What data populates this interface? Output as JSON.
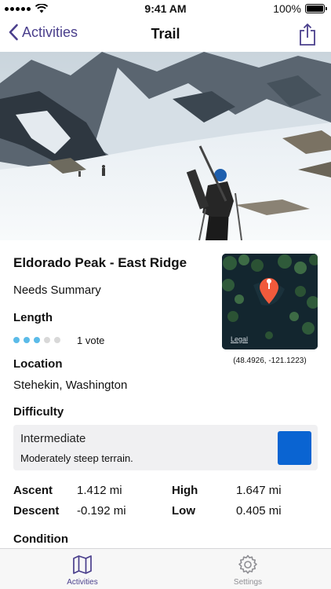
{
  "status_bar": {
    "time": "9:41 AM",
    "battery": "100%"
  },
  "nav": {
    "back_label": "Activities",
    "title": "Trail"
  },
  "trail": {
    "name": "Eldorado Peak - East Ridge",
    "summary": "Needs Summary",
    "length_label": "Length",
    "rating": {
      "filled": 3,
      "total": 5,
      "votes": "1 vote"
    },
    "location_label": "Location",
    "location": "Stehekin, Washington",
    "map": {
      "legal": "Legal",
      "coordinates": "(48.4926, -121.1223)"
    },
    "difficulty_label": "Difficulty",
    "difficulty": {
      "level": "Intermediate",
      "description": "Moderately steep terrain.",
      "color": "#0a64d2"
    },
    "stats": {
      "ascent_label": "Ascent",
      "ascent": "1.412 mi",
      "descent_label": "Descent",
      "descent": "-0.192 mi",
      "high_label": "High",
      "high": "1.647 mi",
      "low_label": "Low",
      "low": "0.405 mi"
    },
    "condition_label": "Condition"
  },
  "tabs": [
    {
      "label": "Activities",
      "icon": "map-icon",
      "active": true
    },
    {
      "label": "Settings",
      "icon": "gear-icon",
      "active": false
    }
  ],
  "colors": {
    "accent": "#4a3f8c",
    "rating_filled": "#5bbbe8",
    "rating_empty": "#d8d8d8",
    "tab_inactive": "#8e8e93",
    "map_pin": "#f05a3c"
  }
}
